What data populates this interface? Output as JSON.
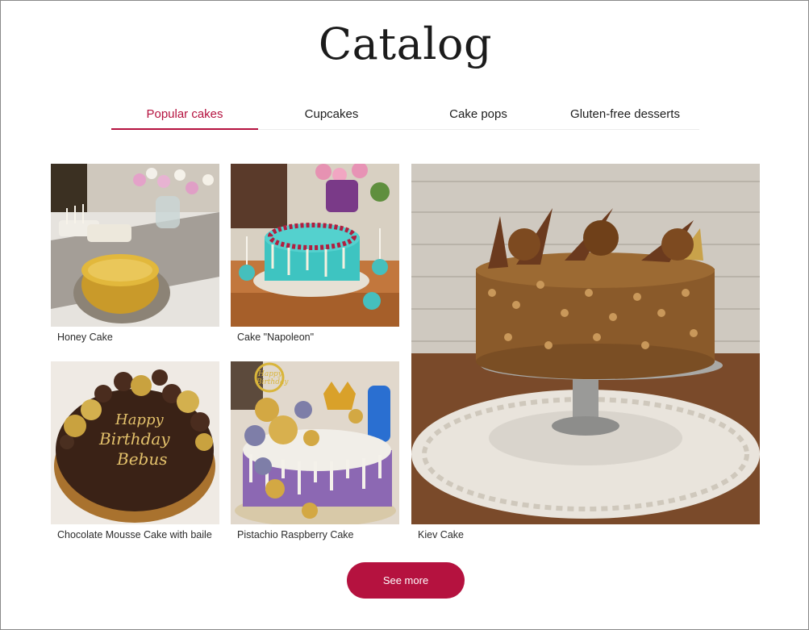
{
  "page": {
    "title": "Catalog"
  },
  "tabs": [
    {
      "label": "Popular cakes",
      "active": true
    },
    {
      "label": "Cupcakes",
      "active": false
    },
    {
      "label": "Cake pops",
      "active": false
    },
    {
      "label": "Gluten-free desserts",
      "active": false
    }
  ],
  "products": [
    {
      "name": "Honey Cake",
      "image": "honey-cake-photo"
    },
    {
      "name": "Cake \"Napoleon\"",
      "image": "napoleon-cake-photo"
    },
    {
      "name": "Kiev Cake",
      "image": "kiev-cake-photo"
    },
    {
      "name": "Chocolate Mousse Cake with baile",
      "image": "chocolate-mousse-cake-photo"
    },
    {
      "name": "Pistachio Raspberry Cake",
      "image": "pistachio-raspberry-cake-photo"
    }
  ],
  "cake_inscriptions": {
    "birthday": [
      "Happy",
      "Birthday",
      "Bebus"
    ],
    "topper": [
      "Happy",
      "Birthday"
    ]
  },
  "actions": {
    "see_more_label": "See more"
  },
  "colors": {
    "accent": "#b5123f",
    "text": "#222222",
    "tab_divider": "#ececec"
  }
}
